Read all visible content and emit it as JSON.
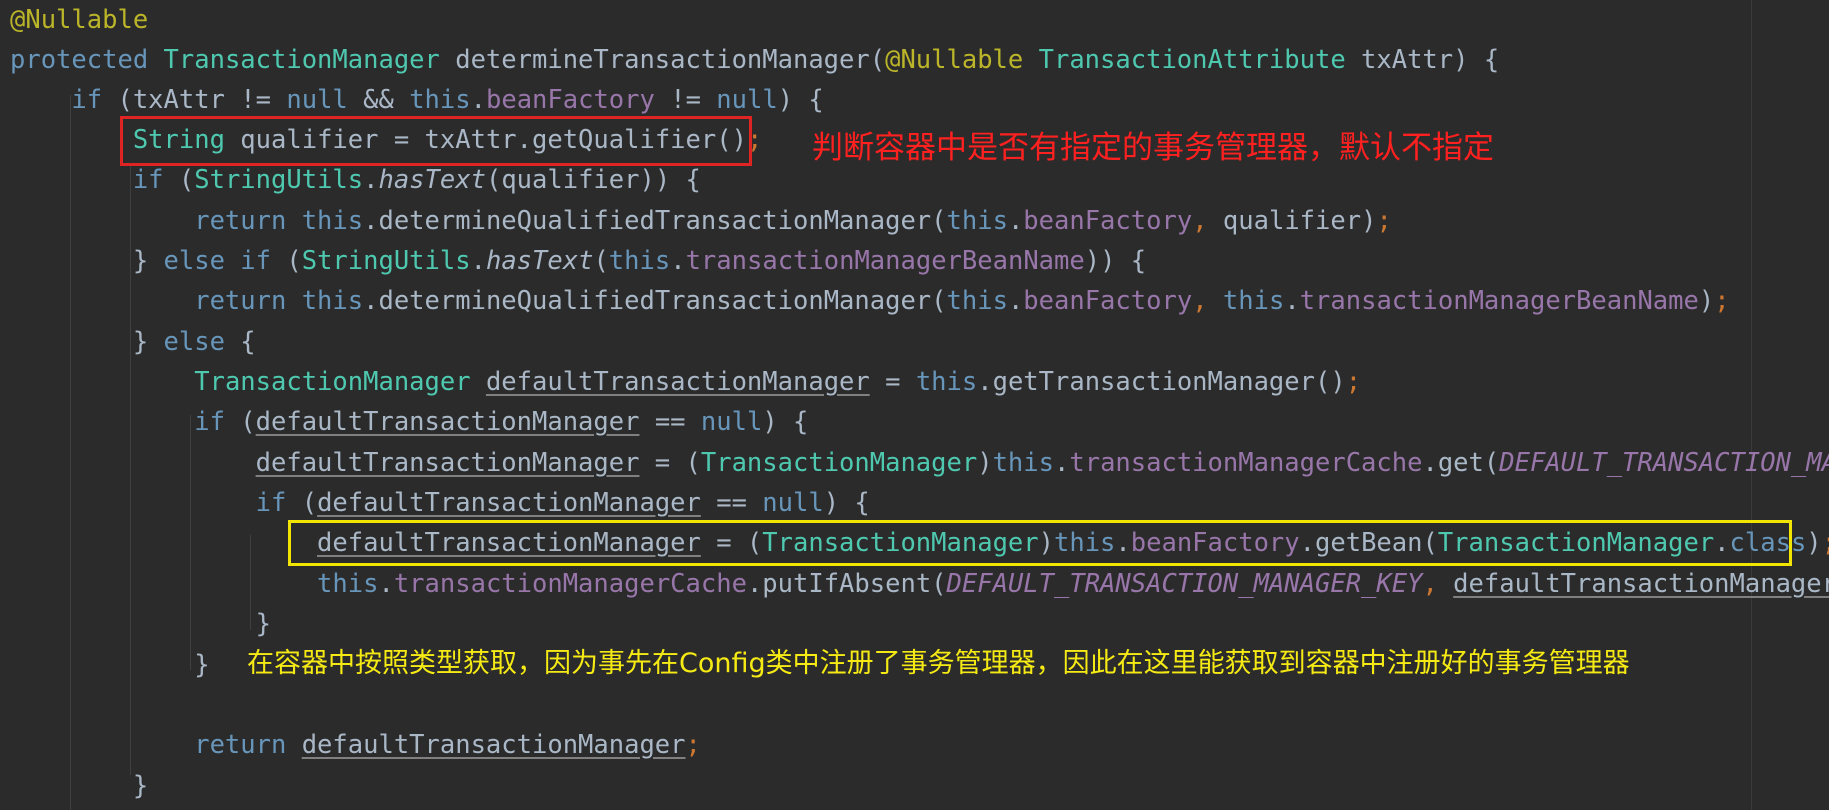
{
  "editor": {
    "colors": {
      "background": "#2b2b2b",
      "annotation": "#bbb529",
      "keyword": "#6896ba",
      "type": "#4ec9b0",
      "field": "#9876aa",
      "text": "#a9b7c6",
      "semicolon": "#cc7832",
      "red_note": "#ff2020",
      "yellow_note": "#f5ea14"
    },
    "lines": [
      [
        {
          "t": "@Nullable",
          "c": "ann"
        }
      ],
      [
        {
          "t": "protected ",
          "c": "kw"
        },
        {
          "t": "TransactionManager",
          "c": "type"
        },
        {
          "t": " determineTransactionManager(",
          "c": "default"
        },
        {
          "t": "@Nullable",
          "c": "ann"
        },
        {
          "t": " ",
          "c": "default"
        },
        {
          "t": "TransactionAttribute",
          "c": "type"
        },
        {
          "t": " txAttr) {",
          "c": "default"
        }
      ],
      [
        {
          "t": "    if ",
          "c": "kw"
        },
        {
          "t": "(txAttr != ",
          "c": "default"
        },
        {
          "t": "null",
          "c": "kw"
        },
        {
          "t": " && ",
          "c": "default"
        },
        {
          "t": "this",
          "c": "kw"
        },
        {
          "t": ".",
          "c": "default"
        },
        {
          "t": "beanFactory",
          "c": "field"
        },
        {
          "t": " != ",
          "c": "default"
        },
        {
          "t": "null",
          "c": "kw"
        },
        {
          "t": ") {",
          "c": "default"
        }
      ],
      [
        {
          "t": "        ",
          "c": "default"
        },
        {
          "t": "String",
          "c": "type"
        },
        {
          "t": " qualifier = txAttr.getQualifier()",
          "c": "default"
        },
        {
          "t": ";",
          "c": "semi"
        }
      ],
      [
        {
          "t": "        if ",
          "c": "kw"
        },
        {
          "t": "(",
          "c": "default"
        },
        {
          "t": "StringUtils",
          "c": "type"
        },
        {
          "t": ".",
          "c": "default"
        },
        {
          "t": "hasText",
          "c": "italic-method"
        },
        {
          "t": "(qualifier)) {",
          "c": "default"
        }
      ],
      [
        {
          "t": "            return ",
          "c": "kw"
        },
        {
          "t": "this",
          "c": "kw"
        },
        {
          "t": ".determineQualifiedTransactionManager(",
          "c": "default"
        },
        {
          "t": "this",
          "c": "kw"
        },
        {
          "t": ".",
          "c": "default"
        },
        {
          "t": "beanFactory",
          "c": "field"
        },
        {
          "t": ", ",
          "c": "semi"
        },
        {
          "t": "qualifier)",
          "c": "default"
        },
        {
          "t": ";",
          "c": "semi"
        }
      ],
      [
        {
          "t": "        } ",
          "c": "default"
        },
        {
          "t": "else if ",
          "c": "kw"
        },
        {
          "t": "(",
          "c": "default"
        },
        {
          "t": "StringUtils",
          "c": "type"
        },
        {
          "t": ".",
          "c": "default"
        },
        {
          "t": "hasText",
          "c": "italic-method"
        },
        {
          "t": "(",
          "c": "default"
        },
        {
          "t": "this",
          "c": "kw"
        },
        {
          "t": ".",
          "c": "default"
        },
        {
          "t": "transactionManagerBeanName",
          "c": "field"
        },
        {
          "t": ")) {",
          "c": "default"
        }
      ],
      [
        {
          "t": "            return ",
          "c": "kw"
        },
        {
          "t": "this",
          "c": "kw"
        },
        {
          "t": ".determineQualifiedTransactionManager(",
          "c": "default"
        },
        {
          "t": "this",
          "c": "kw"
        },
        {
          "t": ".",
          "c": "default"
        },
        {
          "t": "beanFactory",
          "c": "field"
        },
        {
          "t": ", ",
          "c": "semi"
        },
        {
          "t": "this",
          "c": "kw"
        },
        {
          "t": ".",
          "c": "default"
        },
        {
          "t": "transactionManagerBeanName",
          "c": "field"
        },
        {
          "t": ")",
          "c": "default"
        },
        {
          "t": ";",
          "c": "semi"
        }
      ],
      [
        {
          "t": "        } ",
          "c": "default"
        },
        {
          "t": "else ",
          "c": "kw"
        },
        {
          "t": "{",
          "c": "default"
        }
      ],
      [
        {
          "t": "            ",
          "c": "default"
        },
        {
          "t": "TransactionManager",
          "c": "type"
        },
        {
          "t": " ",
          "c": "default"
        },
        {
          "t": "defaultTransactionManager",
          "c": "var"
        },
        {
          "t": " = ",
          "c": "default"
        },
        {
          "t": "this",
          "c": "kw"
        },
        {
          "t": ".getTransactionManager()",
          "c": "default"
        },
        {
          "t": ";",
          "c": "semi"
        }
      ],
      [
        {
          "t": "            if ",
          "c": "kw"
        },
        {
          "t": "(",
          "c": "default"
        },
        {
          "t": "defaultTransactionManager",
          "c": "var"
        },
        {
          "t": " == ",
          "c": "default"
        },
        {
          "t": "null",
          "c": "kw"
        },
        {
          "t": ") {",
          "c": "default"
        }
      ],
      [
        {
          "t": "                ",
          "c": "default"
        },
        {
          "t": "defaultTransactionManager",
          "c": "var"
        },
        {
          "t": " = (",
          "c": "default"
        },
        {
          "t": "TransactionManager",
          "c": "type"
        },
        {
          "t": ")",
          "c": "default"
        },
        {
          "t": "this",
          "c": "kw"
        },
        {
          "t": ".",
          "c": "default"
        },
        {
          "t": "transactionManagerCache",
          "c": "field"
        },
        {
          "t": ".get(",
          "c": "default"
        },
        {
          "t": "DEFAULT_TRANSACTION_MANAG",
          "c": "static"
        }
      ],
      [
        {
          "t": "                if ",
          "c": "kw"
        },
        {
          "t": "(",
          "c": "default"
        },
        {
          "t": "defaultTransactionManager",
          "c": "var"
        },
        {
          "t": " == ",
          "c": "default"
        },
        {
          "t": "null",
          "c": "kw"
        },
        {
          "t": ") {",
          "c": "default"
        }
      ],
      [
        {
          "t": "                    ",
          "c": "default"
        },
        {
          "t": "defaultTransactionManager",
          "c": "var"
        },
        {
          "t": " = (",
          "c": "default"
        },
        {
          "t": "TransactionManager",
          "c": "type"
        },
        {
          "t": ")",
          "c": "default"
        },
        {
          "t": "this",
          "c": "kw"
        },
        {
          "t": ".",
          "c": "default"
        },
        {
          "t": "beanFactory",
          "c": "field"
        },
        {
          "t": ".getBean(",
          "c": "default"
        },
        {
          "t": "TransactionManager",
          "c": "type"
        },
        {
          "t": ".",
          "c": "default"
        },
        {
          "t": "class",
          "c": "kw"
        },
        {
          "t": ")",
          "c": "default"
        },
        {
          "t": ";",
          "c": "semi"
        }
      ],
      [
        {
          "t": "                    ",
          "c": "default"
        },
        {
          "t": "this",
          "c": "kw"
        },
        {
          "t": ".",
          "c": "default"
        },
        {
          "t": "transactionManagerCache",
          "c": "field"
        },
        {
          "t": ".putIfAbsent(",
          "c": "default"
        },
        {
          "t": "DEFAULT_TRANSACTION_MANAGER_KEY",
          "c": "static"
        },
        {
          "t": ", ",
          "c": "semi"
        },
        {
          "t": "defaultTransactionManager",
          "c": "var"
        },
        {
          "t": ")",
          "c": "default"
        },
        {
          "t": ";",
          "c": "semi"
        }
      ],
      [
        {
          "t": "                }",
          "c": "default"
        }
      ],
      [
        {
          "t": "            }",
          "c": "default"
        }
      ],
      [
        {
          "t": "",
          "c": "default"
        }
      ],
      [
        {
          "t": "            return ",
          "c": "kw"
        },
        {
          "t": "defaultTransactionManager",
          "c": "var"
        },
        {
          "t": ";",
          "c": "semi"
        }
      ],
      [
        {
          "t": "        }",
          "c": "default"
        }
      ]
    ]
  },
  "annotations": {
    "red_note": "判断容器中是否有指定的事务管理器，默认不指定",
    "yellow_note": "在容器中按照类型获取，因为事先在Config类中注册了事务管理器，因此在这里能获取到容器中注册好的事务管理器"
  }
}
